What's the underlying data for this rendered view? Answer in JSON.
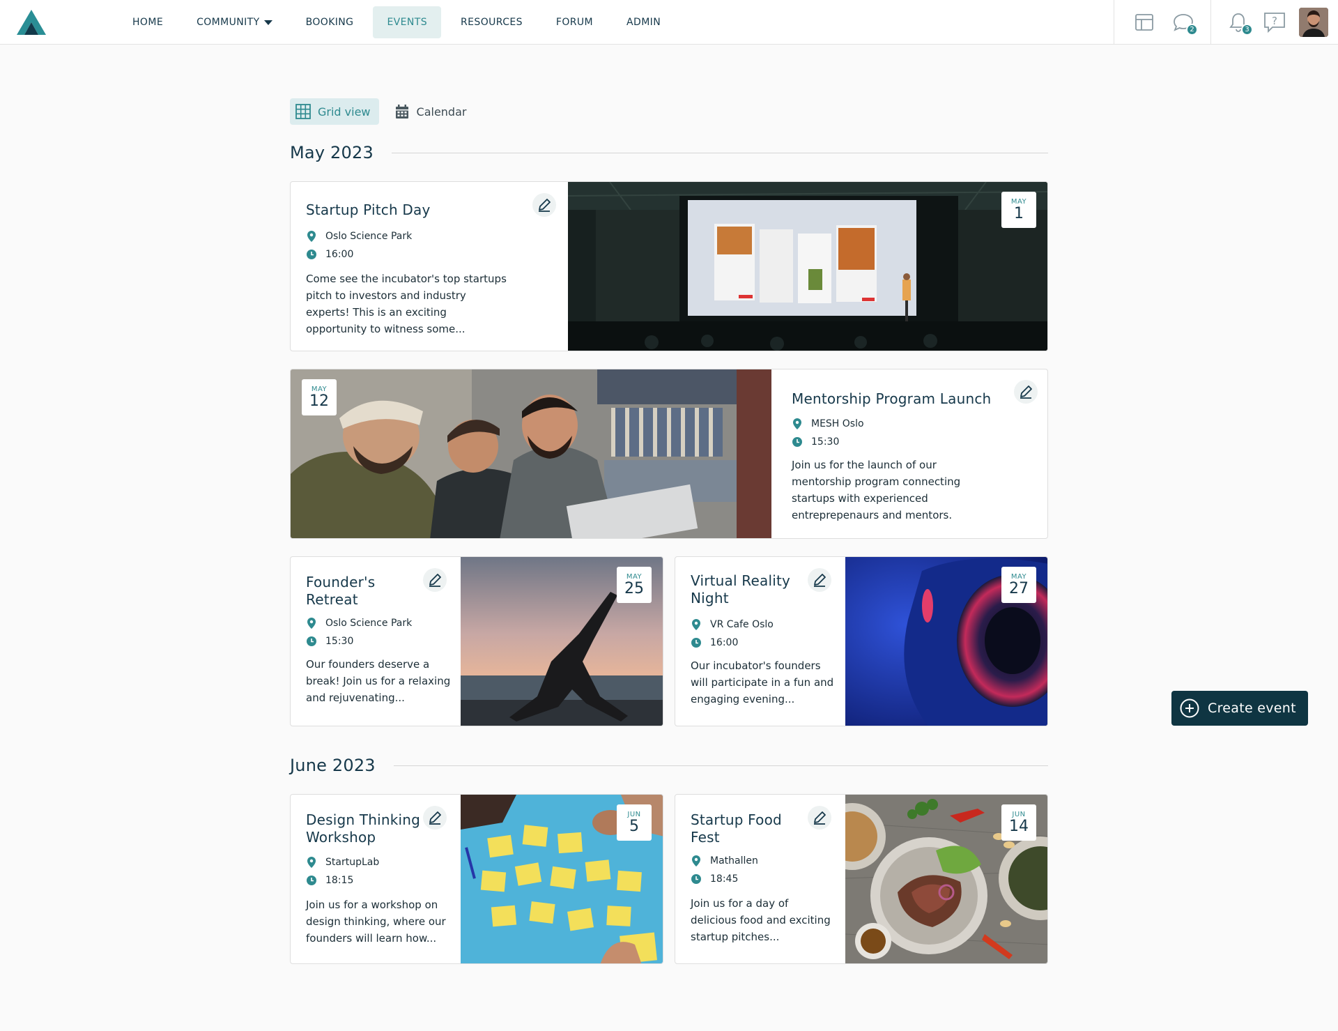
{
  "nav": {
    "items": [
      {
        "label": "HOME",
        "active": false
      },
      {
        "label": "COMMUNITY",
        "active": false,
        "has_dropdown": true
      },
      {
        "label": "BOOKING",
        "active": false
      },
      {
        "label": "EVENTS",
        "active": true
      },
      {
        "label": "RESOURCES",
        "active": false
      },
      {
        "label": "FORUM",
        "active": false
      },
      {
        "label": "ADMIN",
        "active": false
      }
    ]
  },
  "topbar": {
    "chat_badge": "2",
    "notifications_badge": "3",
    "icons": [
      "layout-icon",
      "chat-icon",
      "bell-icon",
      "help-icon",
      "avatar"
    ]
  },
  "view_switch": {
    "grid_label": "Grid view",
    "calendar_label": "Calendar",
    "active": "grid"
  },
  "months": [
    {
      "label": "May 2023"
    },
    {
      "label": "June 2023"
    }
  ],
  "events": [
    {
      "title": "Startup Pitch Day",
      "location": "Oslo Science Park",
      "time": "16:00",
      "description": "Come see the incubator's top startups pitch to investors and industry experts! This is an exciting opportunity to witness some...",
      "month": "MAY",
      "day": "1"
    },
    {
      "title": "Mentorship Program Launch",
      "location": "MESH Oslo",
      "time": "15:30",
      "description": "Join us for the launch of our mentorship program connecting startups with experienced entreprepenaurs and mentors.",
      "month": "MAY",
      "day": "12"
    },
    {
      "title": "Founder's Retreat",
      "location": "Oslo Science Park",
      "time": "15:30",
      "description": "Our founders deserve a break! Join us for a relaxing and rejuvenating...",
      "month": "MAY",
      "day": "25"
    },
    {
      "title": "Virtual Reality Night",
      "location": "VR Cafe Oslo",
      "time": "16:00",
      "description": "Our incubator's founders will participate in a fun and engaging evening...",
      "month": "MAY",
      "day": "27"
    },
    {
      "title": "Design Thinking Workshop",
      "location": "StartupLab",
      "time": "18:15",
      "description": "Join us for a workshop on design thinking, where our founders will learn how...",
      "month": "JUN",
      "day": "5"
    },
    {
      "title": "Startup Food Fest",
      "location": "Mathallen",
      "time": "18:45",
      "description": "Join us for a day of delicious food and exciting startup pitches...",
      "month": "JUN",
      "day": "14"
    }
  ],
  "create_button": {
    "label": "Create event"
  },
  "colors": {
    "accent": "#2e8a8f",
    "primary_dark": "#0f3542",
    "text": "#16384a",
    "active_nav_bg": "#e3efef"
  }
}
